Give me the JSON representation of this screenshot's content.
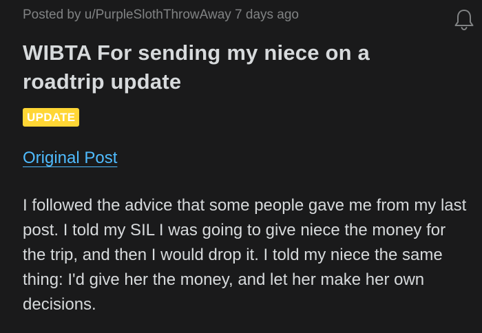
{
  "post": {
    "meta": "Posted by u/PurpleSlothThrowAway 7 days ago",
    "title": "WIBTA For sending my niece on a roadtrip update",
    "flair": "UPDATE",
    "link_label": "Original Post",
    "body": "I followed the advice that some people gave me from my last post. I told my SIL I was going to give niece the money for the trip, and then I would drop it. I told my niece the same thing: I'd give her the money, and let her make her own decisions."
  },
  "icons": {
    "notification": "bell-icon"
  },
  "colors": {
    "background": "#1a1a1b",
    "text": "#d7dadc",
    "meta_text": "#818384",
    "flair_bg": "#ffd635",
    "link": "#4fbcff"
  }
}
